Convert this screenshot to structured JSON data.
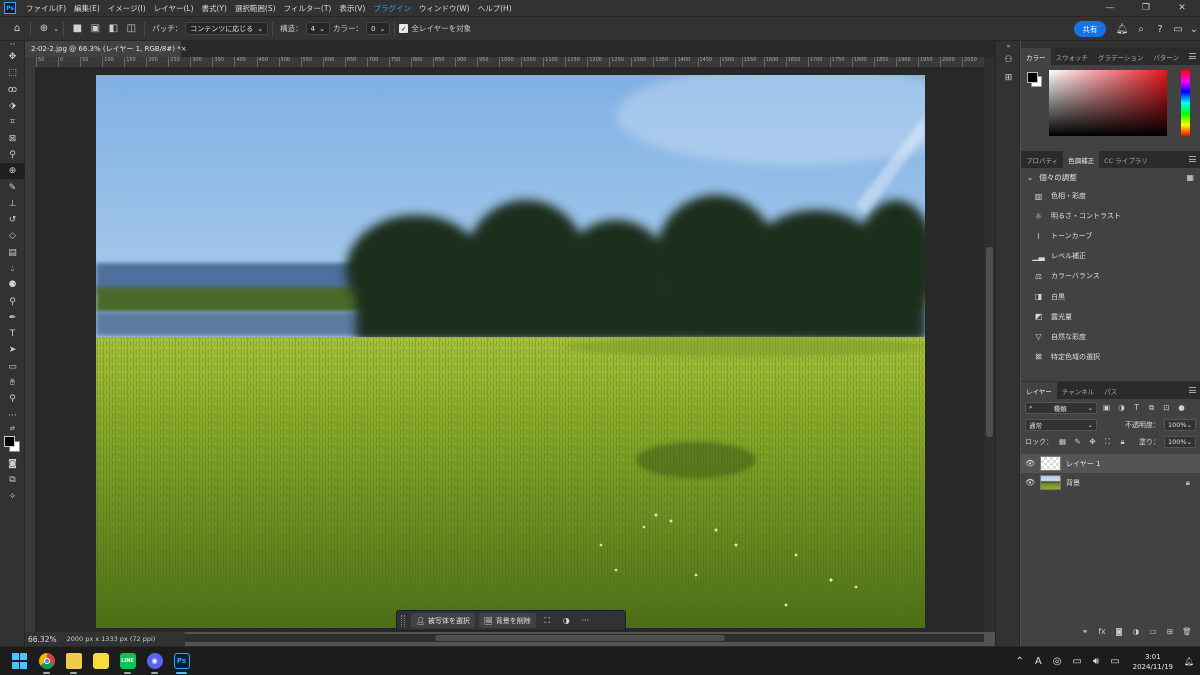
{
  "app": {
    "logo": "Ps",
    "menus": [
      "ファイル(F)",
      "編集(E)",
      "イメージ(I)",
      "レイヤー(L)",
      "書式(Y)",
      "選択範囲(S)",
      "フィルター(T)",
      "表示(V)",
      "プラグイン",
      "ウィンドウ(W)",
      "ヘルプ(H)"
    ],
    "active_menu_index": 8,
    "window_controls": [
      "—",
      "❐",
      "✕"
    ]
  },
  "options_bar": {
    "patch_label": "パッチ：",
    "patch_value": "コンテンツに応じる",
    "structure_label": "構造：",
    "structure_value": "4",
    "color_label": "カラー：",
    "color_value": "0",
    "sample_all_label": "全レイヤーを対象",
    "share_label": "共有"
  },
  "document": {
    "tab_title": "2-02-2.jpg @ 66.3% (レイヤー 1, RGB/8#) *",
    "close_glyph": "×",
    "ruler_ticks": [
      "50",
      "0",
      "50",
      "100",
      "150",
      "200",
      "250",
      "300",
      "350",
      "400",
      "450",
      "500",
      "550",
      "600",
      "650",
      "700",
      "750",
      "800",
      "850",
      "900",
      "950",
      "1000",
      "1050",
      "1100",
      "1150",
      "1200",
      "1250",
      "1300",
      "1350",
      "1400",
      "1450",
      "1500",
      "1550",
      "1600",
      "1650",
      "1700",
      "1750",
      "1800",
      "1850",
      "1900",
      "1950",
      "2000",
      "2050",
      "2100"
    ],
    "zoom": "66.32%",
    "info": "2000 px x 1333 px (72 ppi)"
  },
  "context_bar": {
    "select_subject": "被写体を選択",
    "remove_background": "背景を削除",
    "more": "···"
  },
  "color_panel": {
    "tabs": [
      "カラー",
      "スウォッチ",
      "グラデーション",
      "パターン"
    ],
    "active_tab": 0,
    "foreground": "#000000",
    "background": "#ffffff"
  },
  "adjustments_panel": {
    "tabs": [
      "プロパティ",
      "色調補正",
      "CC ライブラリ"
    ],
    "active_tab": 1,
    "section_title": "個々の調整",
    "items": [
      {
        "label": "色相・彩度",
        "icon": "hue-saturation-icon"
      },
      {
        "label": "明るさ・コントラスト",
        "icon": "brightness-contrast-icon"
      },
      {
        "label": "トーンカーブ",
        "icon": "curves-icon"
      },
      {
        "label": "レベル補正",
        "icon": "levels-icon"
      },
      {
        "label": "カラーバランス",
        "icon": "color-balance-icon"
      },
      {
        "label": "白黒",
        "icon": "black-white-icon"
      },
      {
        "label": "露光量",
        "icon": "exposure-icon"
      },
      {
        "label": "自然な彩度",
        "icon": "vibrance-icon"
      },
      {
        "label": "特定色域の選択",
        "icon": "selective-color-icon"
      }
    ]
  },
  "layers_panel": {
    "tabs": [
      "レイヤー",
      "チャンネル",
      "パス"
    ],
    "active_tab": 0,
    "filter_kind": "種類",
    "blend_mode": "通常",
    "opacity_label": "不透明度：",
    "opacity_value": "100%",
    "lock_label": "ロック：",
    "fill_label": "塗り：",
    "fill_value": "100%",
    "layers": [
      {
        "name": "レイヤー 1",
        "selected": true,
        "locked": false
      },
      {
        "name": "背景",
        "selected": false,
        "locked": true
      }
    ]
  },
  "taskbar": {
    "apps": [
      {
        "name": "windows-start",
        "label": ""
      },
      {
        "name": "chrome",
        "label": ""
      },
      {
        "name": "file-explorer",
        "label": ""
      },
      {
        "name": "sticky-notes",
        "label": ""
      },
      {
        "name": "line",
        "label": "LINE"
      },
      {
        "name": "discord",
        "label": ""
      },
      {
        "name": "photoshop",
        "label": "Ps"
      }
    ],
    "ime": "A",
    "time": "3:01",
    "date": "2024/11/19"
  }
}
